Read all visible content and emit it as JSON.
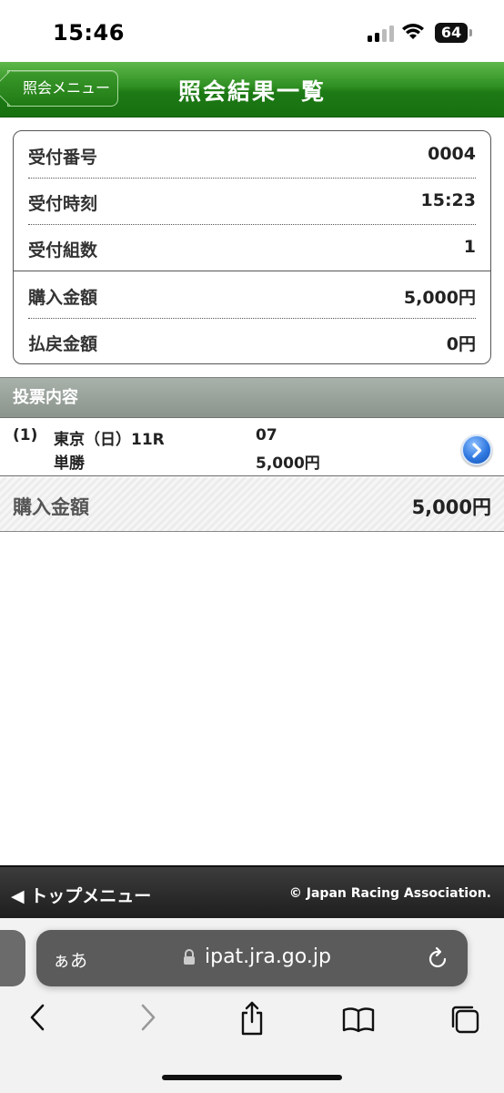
{
  "status_bar": {
    "time": "15:46",
    "battery": "64"
  },
  "header": {
    "back_label": "照会メニュー",
    "title": "照会結果一覧"
  },
  "summary": {
    "rows": [
      {
        "label": "受付番号",
        "value": "0004"
      },
      {
        "label": "受付時刻",
        "value": "15:23"
      },
      {
        "label": "受付組数",
        "value": "1"
      },
      {
        "label": "購入金額",
        "value": "5,000円"
      },
      {
        "label": "払戻金額",
        "value": "0円"
      }
    ]
  },
  "section": {
    "title": "投票内容"
  },
  "bet": {
    "index": "(1)",
    "race": "東京（日）11R",
    "type": "単勝",
    "number": "07",
    "amount": "5,000円"
  },
  "total": {
    "label": "購入金額",
    "value": "5,000円"
  },
  "footer": {
    "top_menu": "◀ トップメニュー",
    "copyright": "© Japan Racing Association."
  },
  "browser": {
    "aa": "ぁあ",
    "url": "ipat.jra.go.jp"
  },
  "colors": {
    "header_green": "#2f8f22",
    "section_gray": "#9aa29c",
    "footer_dark": "#2a2a2a",
    "link_blue": "#2f78e0"
  },
  "icons": [
    "signal-icon",
    "wifi-icon",
    "battery-icon",
    "chevron-right-circle-icon",
    "lock-icon",
    "reload-icon",
    "back-icon",
    "forward-icon",
    "share-icon",
    "bookmarks-icon",
    "tabs-icon"
  ]
}
